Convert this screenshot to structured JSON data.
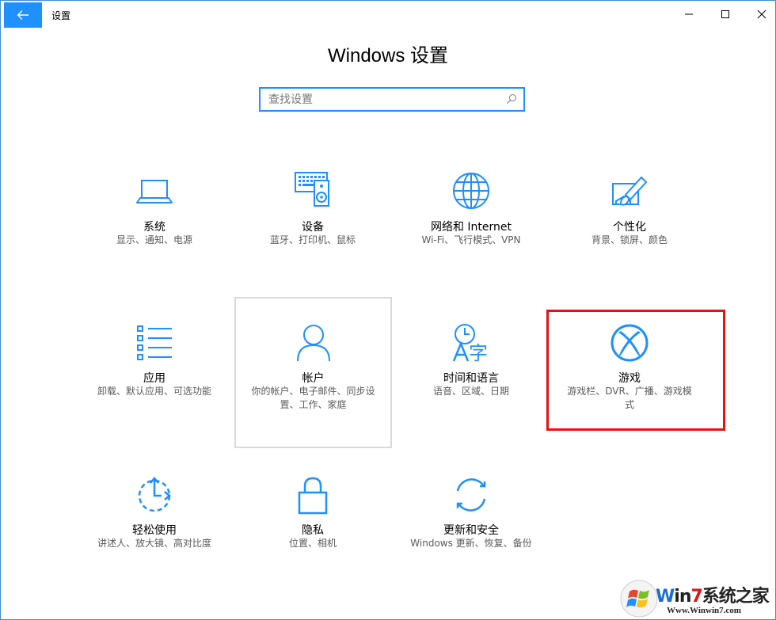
{
  "window": {
    "title": "设置",
    "accent": "#1E90FF",
    "highlight_color": "#E81010"
  },
  "header": {
    "title": "Windows 设置"
  },
  "search": {
    "placeholder": "查找设置"
  },
  "tiles": [
    {
      "name": "系统",
      "desc": "显示、通知、电源",
      "icon": "laptop-icon"
    },
    {
      "name": "设备",
      "desc": "蓝牙、打印机、鼠标",
      "icon": "keyboard-speaker-icon"
    },
    {
      "name": "网络和 Internet",
      "desc": "Wi-Fi、飞行模式、VPN",
      "icon": "globe-icon"
    },
    {
      "name": "个性化",
      "desc": "背景、锁屏、颜色",
      "icon": "paint-brush-icon"
    },
    {
      "name": "应用",
      "desc": "卸载、默认应用、可选功能",
      "icon": "app-list-icon"
    },
    {
      "name": "帐户",
      "desc": "你的帐户、电子邮件、同步设置、工作、家庭",
      "icon": "person-icon"
    },
    {
      "name": "时间和语言",
      "desc": "语音、区域、日期",
      "icon": "clock-language-icon"
    },
    {
      "name": "游戏",
      "desc": "游戏栏、DVR、广播、游戏模式",
      "icon": "xbox-icon"
    },
    {
      "name": "轻松使用",
      "desc": "讲述人、放大镜、高对比度",
      "icon": "ease-of-access-icon"
    },
    {
      "name": "隐私",
      "desc": "位置、相机",
      "icon": "lock-icon"
    },
    {
      "name": "更新和安全",
      "desc": "Windows 更新、恢复、备份",
      "icon": "sync-icon"
    }
  ],
  "watermark": {
    "title_w": "W",
    "title_in": "in",
    "title_seven": "7",
    "title_rest": "系统之家",
    "url": "Www.Winwin7.com"
  }
}
